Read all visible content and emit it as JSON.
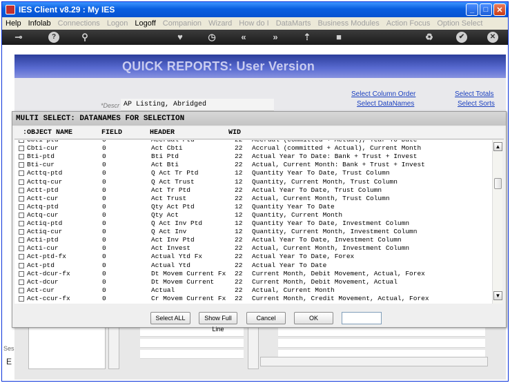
{
  "window": {
    "title": "IES Client v8.29 : My IES"
  },
  "menu": [
    {
      "label": "Help",
      "enabled": true
    },
    {
      "label": "Infolab",
      "enabled": true
    },
    {
      "label": "Connections",
      "enabled": false
    },
    {
      "label": "Logon",
      "enabled": false
    },
    {
      "label": "Logoff",
      "enabled": true
    },
    {
      "label": "Companion",
      "enabled": false
    },
    {
      "label": "Wizard",
      "enabled": false
    },
    {
      "label": "How do I",
      "enabled": false
    },
    {
      "label": "DataMarts",
      "enabled": false
    },
    {
      "label": "Business Modules",
      "enabled": false
    },
    {
      "label": "Action Focus",
      "enabled": false
    },
    {
      "label": "Option Select",
      "enabled": false
    }
  ],
  "toolbar": {
    "icons": [
      "key-icon",
      "help-icon",
      "search-icon",
      "heart-icon",
      "clock-icon",
      "rewind-icon",
      "forward-icon",
      "upload-icon",
      "stop-icon",
      "recycle-icon",
      "check-icon",
      "close-icon"
    ],
    "help_glyph": "?",
    "rewind_glyph": "«",
    "forward_glyph": "»",
    "check_glyph": "✔",
    "close_glyph": "✕"
  },
  "page": {
    "banner_title": "QUICK REPORTS: User Version",
    "descr_label": "*Descr",
    "descr_value": "AP Listing, Abridged",
    "link_column_order": "Select Column Order",
    "link_datanames": "Select DataNames",
    "link_totals": "Select Totals",
    "link_sorts": "Select Sorts",
    "side_text_1": "Ses",
    "side_text_2": "E"
  },
  "dialog": {
    "title": "MULTI SELECT: DATANAMES FOR SELECTION",
    "columns": [
      ":OBJECT NAME",
      "FIELD",
      "HEADER",
      "WID"
    ],
    "rows": [
      {
        "name": "Cbti-ptd",
        "field": "0",
        "header": "Accrual Ptd",
        "wid": "22",
        "desc": "Accrual (committed + Actual), Year To Date"
      },
      {
        "name": "Cbti-cur",
        "field": "0",
        "header": "Act Cbti",
        "wid": "22",
        "desc": "Accrual (committed + Actual), Current Month"
      },
      {
        "name": "Bti-ptd",
        "field": "0",
        "header": "Bti Ptd",
        "wid": "22",
        "desc": "Actual Year To Date: Bank + Trust + Invest"
      },
      {
        "name": "Bti-cur",
        "field": "0",
        "header": "Act Bti",
        "wid": "22",
        "desc": "Actual, Current Month: Bank + Trust + Invest"
      },
      {
        "name": "Acttq-ptd",
        "field": "0",
        "header": "Q Act Tr Ptd",
        "wid": "12",
        "desc": "Quantity Year To Date, Trust Column"
      },
      {
        "name": "Acttq-cur",
        "field": "0",
        "header": "Q Act Trust",
        "wid": "12",
        "desc": "Quantity, Current Month, Trust Column"
      },
      {
        "name": "Actt-ptd",
        "field": "0",
        "header": "Act Tr Ptd",
        "wid": "22",
        "desc": "Actual Year To Date, Trust Column"
      },
      {
        "name": "Actt-cur",
        "field": "0",
        "header": "Act Trust",
        "wid": "22",
        "desc": "Actual, Current Month, Trust Column"
      },
      {
        "name": "Actq-ptd",
        "field": "0",
        "header": "Qty Act Ptd",
        "wid": "12",
        "desc": "Quantity Year To Date"
      },
      {
        "name": "Actq-cur",
        "field": "0",
        "header": "Qty Act",
        "wid": "12",
        "desc": "Quantity, Current Month"
      },
      {
        "name": "Actiq-ptd",
        "field": "0",
        "header": "Q Act Inv Ptd",
        "wid": "12",
        "desc": "Quantity Year To Date, Investment Column"
      },
      {
        "name": "Actiq-cur",
        "field": "0",
        "header": "Q Act Inv",
        "wid": "12",
        "desc": "Quantity, Current Month, Investment Column"
      },
      {
        "name": "Acti-ptd",
        "field": "0",
        "header": "Act Inv Ptd",
        "wid": "22",
        "desc": "Actual Year To Date, Investment Column"
      },
      {
        "name": "Acti-cur",
        "field": "0",
        "header": "Act Invest",
        "wid": "22",
        "desc": "Actual, Current Month, Investment Column"
      },
      {
        "name": "Act-ptd-fx",
        "field": "0",
        "header": "Actual Ytd Fx",
        "wid": "22",
        "desc": "Actual Year To Date, Forex"
      },
      {
        "name": "Act-ptd",
        "field": "0",
        "header": "Actual Ytd",
        "wid": "22",
        "desc": "Actual Year To Date"
      },
      {
        "name": "Act-dcur-fx",
        "field": "0",
        "header": "Dt Movem Current Fx",
        "wid": "22",
        "desc": "Current Month, Debit Movement, Actual, Forex"
      },
      {
        "name": "Act-dcur",
        "field": "0",
        "header": "Dt Movem Current",
        "wid": "22",
        "desc": "Current Month, Debit Movement, Actual"
      },
      {
        "name": "Act-cur",
        "field": "0",
        "header": "Actual",
        "wid": "22",
        "desc": "Actual, Current Month"
      },
      {
        "name": "Act-ccur-fx",
        "field": "0",
        "header": "Cr Movem Current Fx",
        "wid": "22",
        "desc": "Current Month, Credit Movement, Actual, Forex"
      }
    ],
    "buttons": {
      "select_all": "Select ALL",
      "show_full_line": "Show Full Line",
      "cancel": "Cancel",
      "ok": "OK"
    },
    "scroll_up_glyph": "▲",
    "scroll_down_glyph": "▼"
  }
}
